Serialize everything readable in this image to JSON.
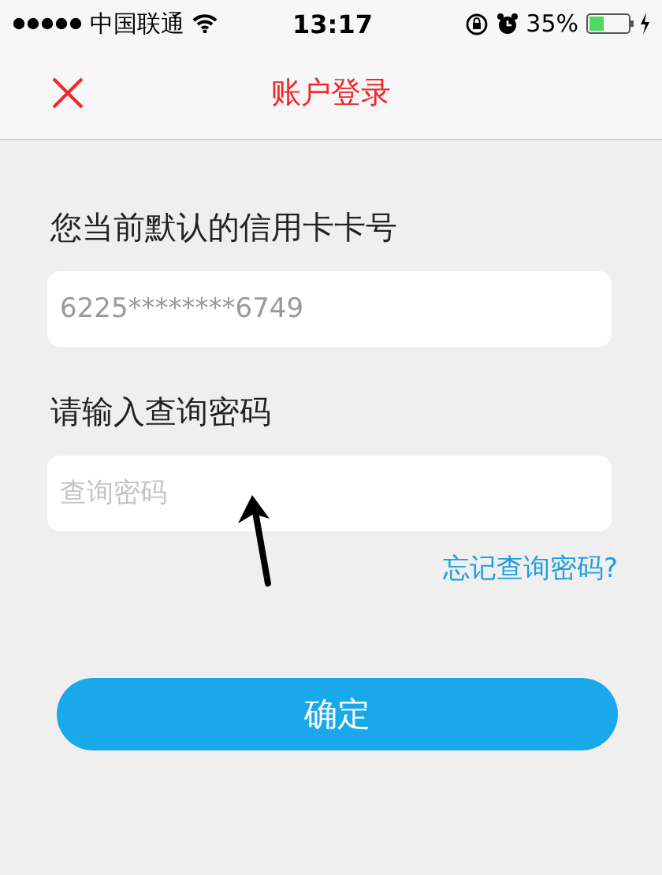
{
  "status_bar": {
    "carrier": "中国联通",
    "time": "13:17",
    "battery": "35%"
  },
  "nav": {
    "title": "账户登录"
  },
  "form": {
    "card_label": "您当前默认的信用卡卡号",
    "card_value": "6225********6749",
    "password_label": "请输入查询密码",
    "password_placeholder": "查询密码",
    "forgot_link": "忘记查询密码?",
    "submit": "确定"
  }
}
